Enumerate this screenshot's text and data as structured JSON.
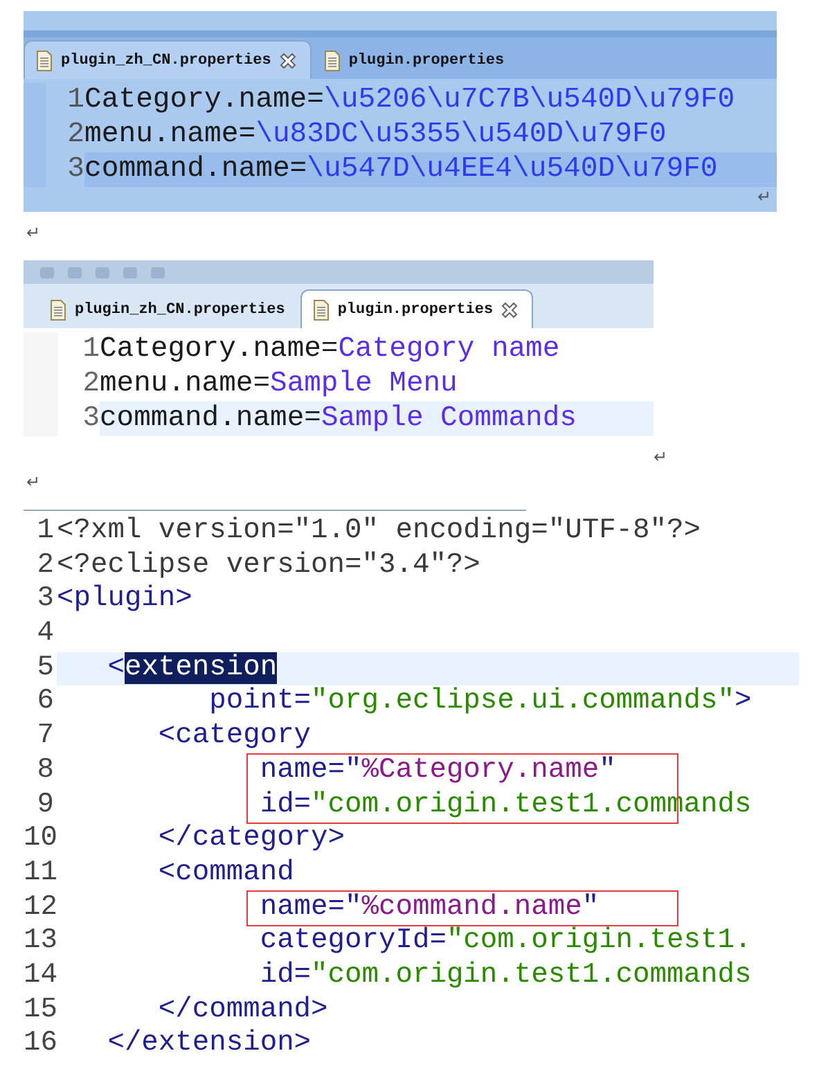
{
  "blocks": [
    {
      "kind": "properties",
      "selected": true,
      "mark": "↵",
      "tabs": [
        {
          "label": "plugin_zh_CN.properties",
          "selected": true,
          "closable": true
        },
        {
          "label": "plugin.properties",
          "selected": false,
          "closable": false
        }
      ],
      "lines": [
        {
          "number": "1",
          "key": "Category.name=",
          "value": "\\u5206\\u7C7B\\u540D\\u79F0",
          "current": false
        },
        {
          "number": "2",
          "key": "menu.name=",
          "value": "\\u83DC\\u5355\\u540D\\u79F0",
          "current": false
        },
        {
          "number": "3",
          "key": "command.name=",
          "value": "\\u547D\\u4EE4\\u540D\\u79F0",
          "current": true
        }
      ]
    },
    {
      "kind": "paragraph",
      "text": "↵"
    },
    {
      "kind": "properties",
      "selected": false,
      "mark": "↵",
      "tabs": [
        {
          "label": "plugin_zh_CN.properties",
          "selected": false,
          "closable": false
        },
        {
          "label": "plugin.properties",
          "selected": true,
          "closable": true
        }
      ],
      "lines": [
        {
          "number": "1",
          "key": "Category.name=",
          "value": "Category name",
          "current": false
        },
        {
          "number": "2",
          "key": "menu.name=",
          "value": "Sample Menu",
          "current": false
        },
        {
          "number": "3",
          "key": "command.name=",
          "value": "Sample Commands",
          "current": true
        }
      ]
    },
    {
      "kind": "paragraph",
      "text": "↵"
    },
    {
      "kind": "xml",
      "lines": [
        {
          "number": "1",
          "current": false,
          "boxed": false,
          "segments": [
            {
              "kind": "pi",
              "text": "<?xml version=\"1.0\" encoding=\"UTF-8\"?>"
            }
          ]
        },
        {
          "number": "2",
          "current": false,
          "boxed": false,
          "segments": [
            {
              "kind": "pi",
              "text": "<?eclipse version=\"3.4\"?>"
            }
          ]
        },
        {
          "number": "3",
          "current": false,
          "boxed": false,
          "segments": [
            {
              "kind": "tag",
              "text": "<plugin>"
            }
          ]
        },
        {
          "number": "4",
          "current": false,
          "boxed": false
        },
        {
          "number": "5",
          "current": true,
          "boxed": false,
          "segments": [
            {
              "kind": "tag",
              "text": "   <"
            },
            {
              "kind": "selection",
              "text": "extension"
            }
          ]
        },
        {
          "number": "6",
          "current": false,
          "boxed": false,
          "segments": [
            {
              "kind": "attr",
              "text": "         point="
            },
            {
              "kind": "string",
              "text": "\"org.eclipse.ui.commands\""
            },
            {
              "kind": "tag",
              "text": ">"
            }
          ]
        },
        {
          "number": "7",
          "current": false,
          "boxed": false,
          "segments": [
            {
              "kind": "tag",
              "text": "      <category"
            }
          ]
        },
        {
          "number": "8",
          "current": false,
          "boxed": true,
          "segments": [
            {
              "kind": "attr",
              "text": "            name=\""
            },
            {
              "kind": "ref",
              "text": "%Category.name"
            },
            {
              "kind": "attr",
              "text": "\""
            }
          ]
        },
        {
          "number": "9",
          "current": false,
          "boxed": true,
          "segments": [
            {
              "kind": "attr",
              "text": "            id="
            },
            {
              "kind": "string",
              "text": "\"com.origin.test1.commands"
            }
          ]
        },
        {
          "number": "10",
          "current": false,
          "boxed": false,
          "segments": [
            {
              "kind": "tag",
              "text": "      </category>"
            }
          ]
        },
        {
          "number": "11",
          "current": false,
          "boxed": false,
          "segments": [
            {
              "kind": "tag",
              "text": "      <command"
            }
          ]
        },
        {
          "number": "12",
          "current": false,
          "boxed": true,
          "segments": [
            {
              "kind": "attr",
              "text": "            name=\""
            },
            {
              "kind": "ref",
              "text": "%command.name"
            },
            {
              "kind": "attr",
              "text": "\""
            }
          ]
        },
        {
          "number": "13",
          "current": false,
          "boxed": false,
          "segments": [
            {
              "kind": "attr",
              "text": "            categoryId="
            },
            {
              "kind": "string",
              "text": "\"com.origin.test1."
            }
          ]
        },
        {
          "number": "14",
          "current": false,
          "boxed": false,
          "segments": [
            {
              "kind": "attr",
              "text": "            id="
            },
            {
              "kind": "string",
              "text": "\"com.origin.test1.commands"
            }
          ]
        },
        {
          "number": "15",
          "current": false,
          "boxed": false,
          "segments": [
            {
              "kind": "tag",
              "text": "      </command>"
            }
          ]
        },
        {
          "number": "16",
          "current": false,
          "boxed": false,
          "segments": [
            {
              "kind": "tag",
              "text": "   </extension>"
            }
          ]
        }
      ]
    }
  ]
}
